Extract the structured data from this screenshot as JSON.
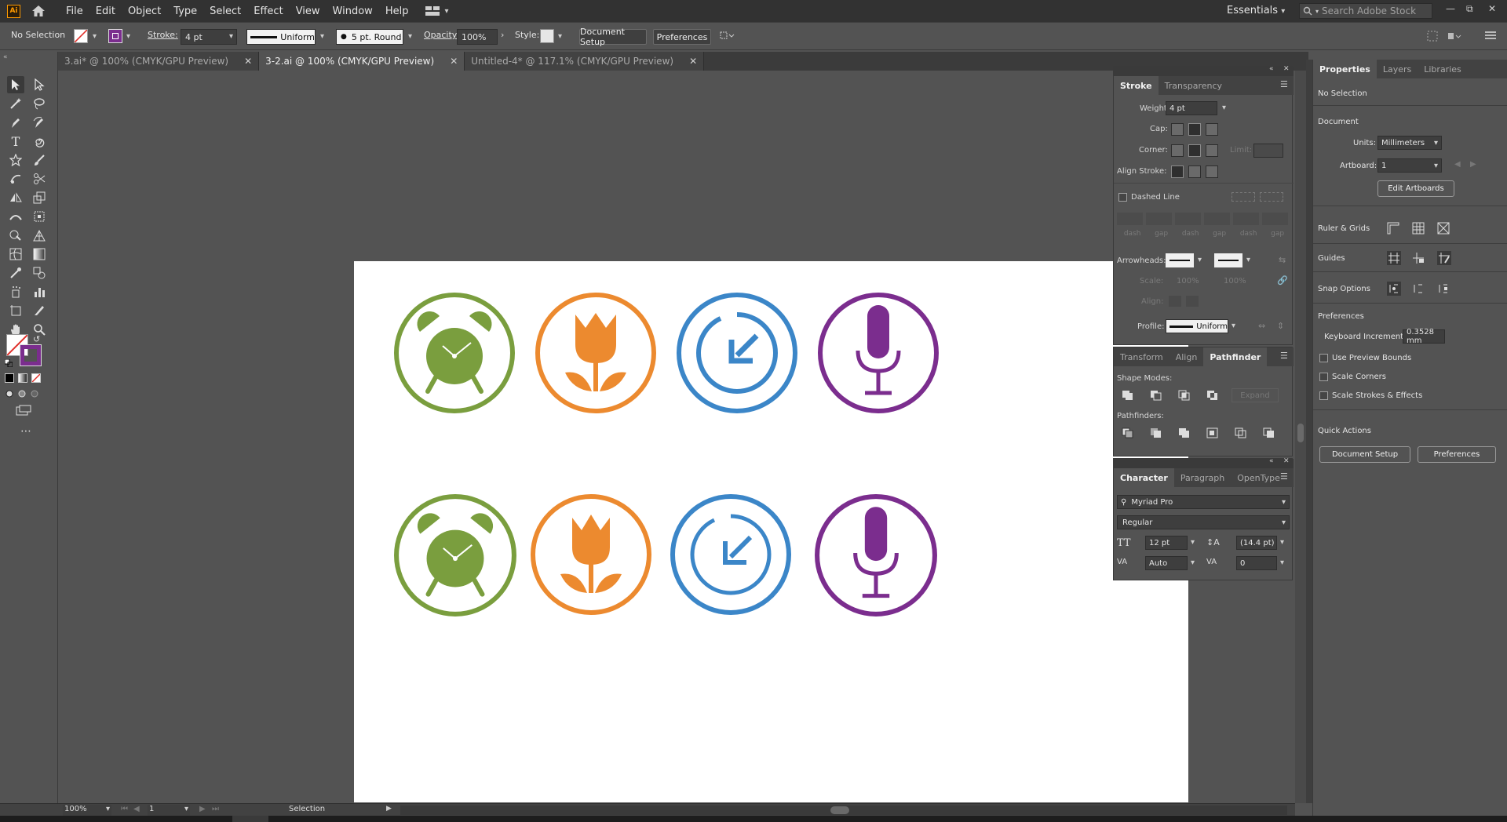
{
  "app": {
    "logo": "Ai"
  },
  "menu": [
    "File",
    "Edit",
    "Object",
    "Type",
    "Select",
    "Effect",
    "View",
    "Window",
    "Help"
  ],
  "workspace": "Essentials",
  "search": {
    "placeholder": "Search Adobe Stock"
  },
  "control": {
    "selection": "No Selection",
    "stroke_label": "Stroke:",
    "stroke_value": "4 pt",
    "profile": "Uniform",
    "brush": "5 pt. Round",
    "opacity_label": "Opacity:",
    "opacity_value": "100%",
    "style_label": "Style:",
    "doc_setup": "Document Setup",
    "preferences": "Preferences"
  },
  "tabs": [
    {
      "label": "3.ai* @ 100% (CMYK/GPU Preview)"
    },
    {
      "label": "3-2.ai @ 100% (CMYK/GPU Preview)"
    },
    {
      "label": "Untitled-4* @ 117.1% (CMYK/GPU Preview)"
    }
  ],
  "colors": {
    "green": "#7a9e3e",
    "orange": "#ec8a2f",
    "blue": "#3b86c8",
    "purple": "#7b2d8e",
    "ui_bg": "#535353"
  },
  "artboard_icons": {
    "row1": [
      "alarm-clock-icon",
      "tulip-icon",
      "arrow-return-icon",
      "microphone-icon"
    ],
    "row2": [
      "alarm-clock-icon",
      "tulip-icon",
      "arrow-return-icon",
      "microphone-icon"
    ]
  },
  "stroke_panel": {
    "tab_stroke": "Stroke",
    "tab_transparency": "Transparency",
    "weight_label": "Weight:",
    "weight_value": "4 pt",
    "cap_label": "Cap:",
    "corner_label": "Corner:",
    "limit_label": "Limit:",
    "align_label": "Align Stroke:",
    "dashed_label": "Dashed Line",
    "dash_labels": [
      "dash",
      "gap",
      "dash",
      "gap",
      "dash",
      "gap"
    ],
    "arrowheads_label": "Arrowheads:",
    "scale_label": "Scale:",
    "scale_a": "100%",
    "scale_b": "100%",
    "align2_label": "Align:",
    "profile_label": "Profile:",
    "profile_value": "Uniform"
  },
  "pathfinder_panel": {
    "tab_transform": "Transform",
    "tab_align": "Align",
    "tab_pathfinder": "Pathfinder",
    "shape_modes": "Shape Modes:",
    "expand": "Expand",
    "pathfinders": "Pathfinders:"
  },
  "character_panel": {
    "tab_character": "Character",
    "tab_paragraph": "Paragraph",
    "tab_opentype": "OpenType",
    "font": "Myriad Pro",
    "style": "Regular",
    "size": "12 pt",
    "leading": "(14.4 pt)",
    "kerning": "Auto",
    "tracking": "0"
  },
  "properties_panel": {
    "tab_properties": "Properties",
    "tab_layers": "Layers",
    "tab_libraries": "Libraries",
    "selection": "No Selection",
    "document": "Document",
    "units_label": "Units:",
    "units_value": "Millimeters",
    "artboard_label": "Artboard:",
    "artboard_value": "1",
    "edit_artboards": "Edit Artboards",
    "ruler_grids": "Ruler & Grids",
    "guides": "Guides",
    "snap_options": "Snap Options",
    "preferences": "Preferences",
    "keyboard_increment_label": "Keyboard Increment:",
    "keyboard_increment_value": "0.3528 mm",
    "use_preview_bounds": "Use Preview Bounds",
    "scale_corners": "Scale Corners",
    "scale_strokes": "Scale Strokes & Effects",
    "quick_actions": "Quick Actions",
    "doc_setup_btn": "Document Setup",
    "preferences_btn": "Preferences"
  },
  "status": {
    "zoom": "100%",
    "artboard_num": "1",
    "tool": "Selection"
  }
}
